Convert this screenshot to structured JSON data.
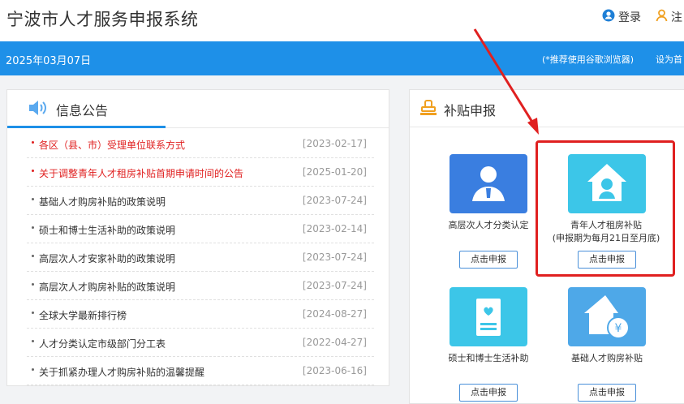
{
  "header": {
    "site_title": "宁波市人才服务申报系统",
    "login_label": "登录",
    "register_label": "注"
  },
  "bar": {
    "date": "2025年03月07日",
    "browser_tip": "(*推荐使用谷歌浏览器)",
    "set_home": "设为首"
  },
  "announcements": {
    "title": "信息公告",
    "items": [
      {
        "title": "各区（县、市）受理单位联系方式",
        "date": "[2023-02-17]",
        "highlight": true
      },
      {
        "title": "关于调整青年人才租房补贴首期申请时间的公告",
        "date": "[2025-01-20]",
        "highlight": true
      },
      {
        "title": "基础人才购房补贴的政策说明",
        "date": "[2023-07-24]",
        "highlight": false
      },
      {
        "title": "硕士和博士生活补助的政策说明",
        "date": "[2023-02-14]",
        "highlight": false
      },
      {
        "title": "高层次人才安家补助的政策说明",
        "date": "[2023-07-24]",
        "highlight": false
      },
      {
        "title": "高层次人才购房补贴的政策说明",
        "date": "[2023-07-24]",
        "highlight": false
      },
      {
        "title": "全球大学最新排行榜",
        "date": "[2024-08-27]",
        "highlight": false
      },
      {
        "title": "人才分类认定市级部门分工表",
        "date": "[2022-04-27]",
        "highlight": false
      },
      {
        "title": "关于抓紧办理人才购房补贴的温馨提醒",
        "date": "[2023-06-16]",
        "highlight": false
      }
    ]
  },
  "subsidies": {
    "title": "补贴申报",
    "apply_label": "点击申报",
    "items": [
      {
        "name": "高层次人才分类认定",
        "note": ""
      },
      {
        "name": "青年人才租房补贴",
        "note": "(申报期为每月21日至月底)"
      },
      {
        "name": "硕士和博士生活补助",
        "note": ""
      },
      {
        "name": "基础人才购房补贴",
        "note": ""
      }
    ]
  },
  "colors": {
    "primary": "#1e90e8",
    "highlight_red": "#e02020",
    "tile_blue": "#3a7ee0",
    "tile_cyan": "#3cc6e8"
  },
  "icons": [
    "user-icon",
    "person-icon",
    "speaker-icon",
    "stamp-icon",
    "portrait-icon",
    "house-user-icon",
    "heart-hands-icon",
    "house-yen-icon"
  ]
}
